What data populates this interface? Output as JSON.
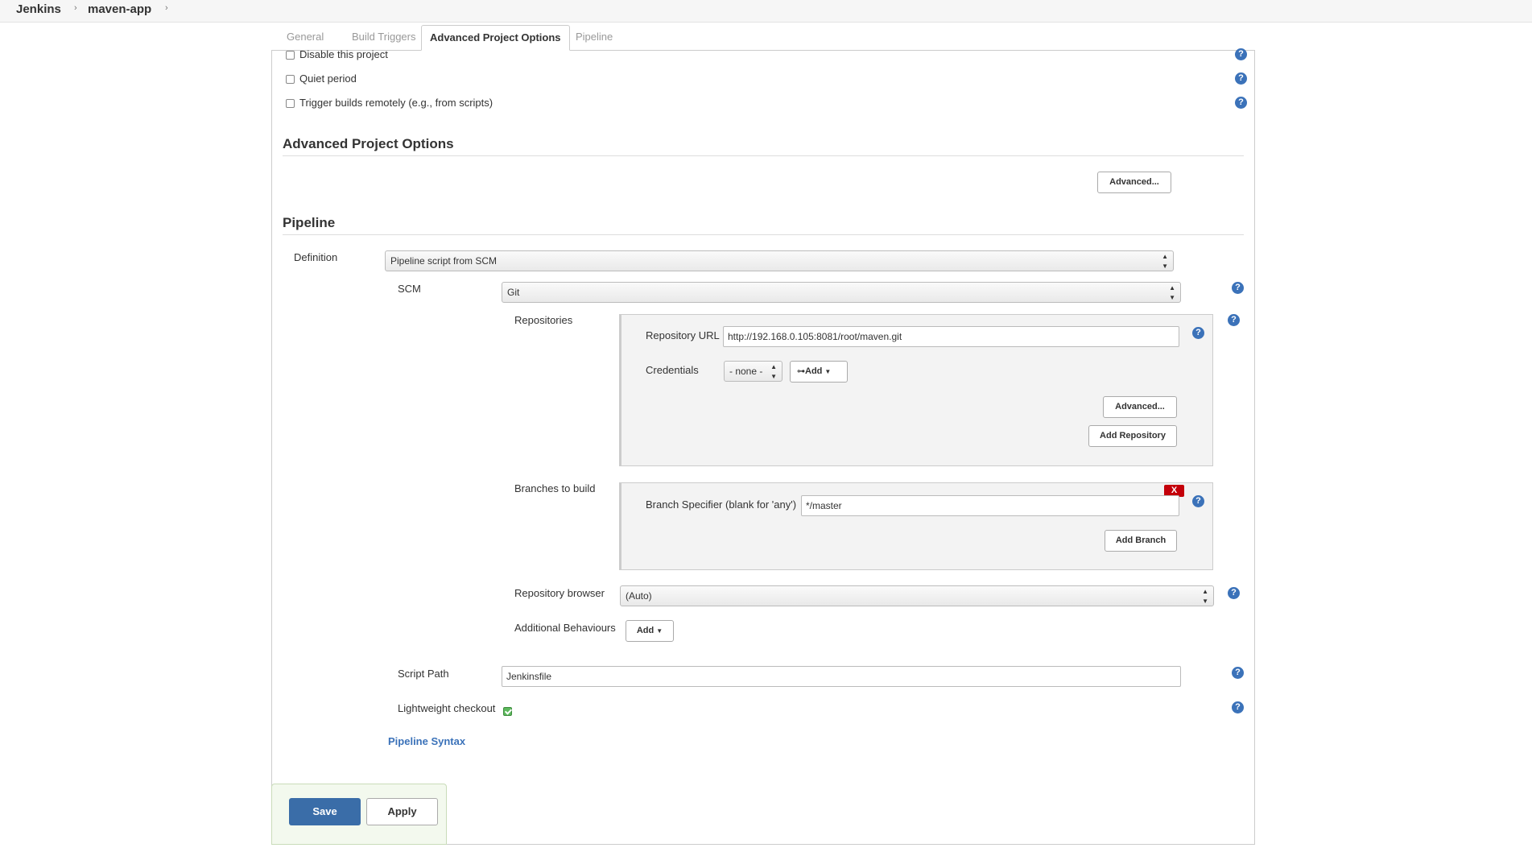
{
  "breadcrumb": {
    "home": "Jenkins",
    "job": "maven-app",
    "separator": "›"
  },
  "tabs": [
    "General",
    "Build Triggers",
    "Advanced Project Options",
    "Pipeline"
  ],
  "triggers": {
    "disable_project": "Disable this project",
    "quiet_period": "Quiet period",
    "trigger_remotely": "Trigger builds remotely (e.g., from scripts)"
  },
  "advanced_options": {
    "title": "Advanced Project Options",
    "advanced_button": "Advanced..."
  },
  "pipeline": {
    "title": "Pipeline",
    "definition_label": "Definition",
    "definition_value": "Pipeline script from SCM",
    "scm_label": "SCM",
    "scm_value": "Git",
    "repositories_label": "Repositories",
    "repo_url_label": "Repository URL",
    "repo_url_value": "http://192.168.0.105:8081/root/maven.git",
    "credentials_label": "Credentials",
    "credentials_value": "- none -",
    "credentials_add": "Add",
    "repo_advanced_button": "Advanced...",
    "add_repository_button": "Add Repository",
    "branches_label": "Branches to build",
    "branch_spec_label": "Branch Specifier (blank for 'any')",
    "branch_spec_value": "*/master",
    "delete_branch": "X",
    "add_branch_button": "Add Branch",
    "repo_browser_label": "Repository browser",
    "repo_browser_value": "(Auto)",
    "additional_behaviours_label": "Additional Behaviours",
    "additional_behaviours_add": "Add",
    "script_path_label": "Script Path",
    "script_path_value": "Jenkinsfile",
    "lightweight_label": "Lightweight checkout",
    "lightweight_checked": true,
    "syntax_link": "Pipeline Syntax"
  },
  "actions": {
    "save": "Save",
    "apply": "Apply"
  },
  "help_icon_text": "?"
}
